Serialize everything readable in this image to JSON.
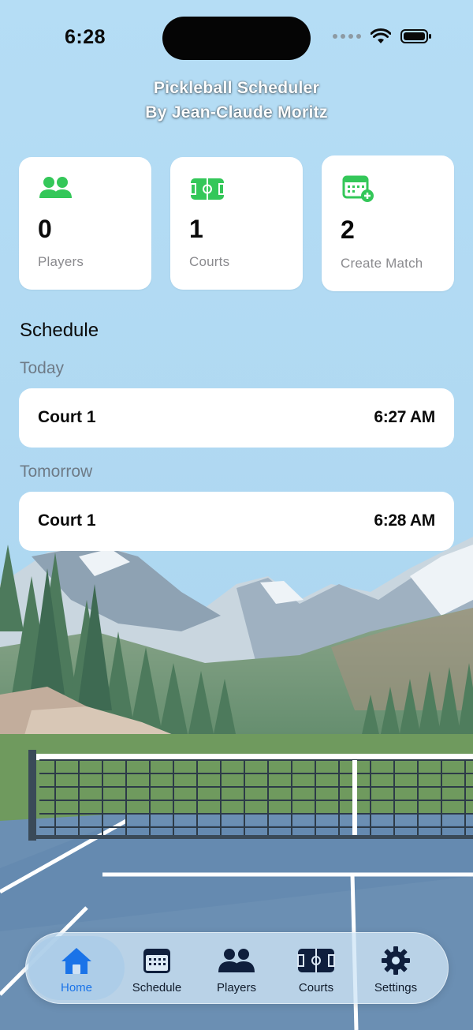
{
  "status_bar": {
    "time": "6:28"
  },
  "header": {
    "title": "Pickleball Scheduler",
    "subtitle": "By Jean-Claude Moritz"
  },
  "stats": [
    {
      "icon": "players-icon",
      "value": "0",
      "label": "Players"
    },
    {
      "icon": "court-icon",
      "value": "1",
      "label": "Courts"
    },
    {
      "icon": "calendar-add-icon",
      "value": "2",
      "label": "Create Match"
    }
  ],
  "schedule": {
    "title": "Schedule",
    "days": [
      {
        "label": "Today",
        "matches": [
          {
            "court": "Court 1",
            "time": "6:27 AM"
          }
        ]
      },
      {
        "label": "Tomorrow",
        "matches": [
          {
            "court": "Court 1",
            "time": "6:28 AM"
          }
        ]
      }
    ]
  },
  "tab_bar": {
    "active": "Home",
    "tabs": [
      {
        "label": "Home",
        "icon": "house-icon"
      },
      {
        "label": "Schedule",
        "icon": "calendar-icon"
      },
      {
        "label": "Players",
        "icon": "people-icon"
      },
      {
        "label": "Courts",
        "icon": "court-icon"
      },
      {
        "label": "Settings",
        "icon": "gear-icon"
      }
    ]
  },
  "colors": {
    "accent_green": "#34c759",
    "accent_blue": "#1a73e8",
    "tab_icon_navy": "#0f1f3d",
    "sky": "#b3dcf4",
    "court_blue": "#6b8fb3",
    "grass": "#6f9a5e"
  }
}
